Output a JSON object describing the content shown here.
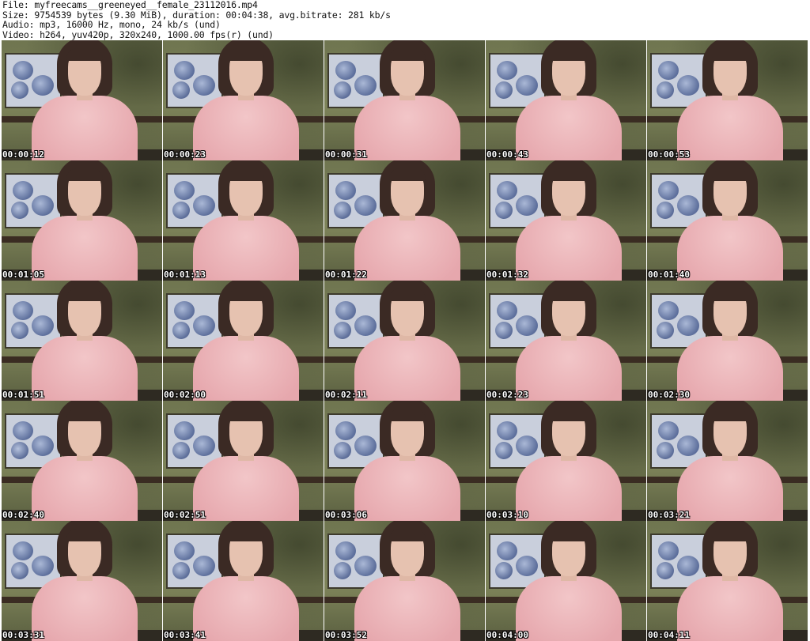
{
  "header": {
    "file_line": "File: myfreecams__greeneyed__female_23112016.mp4",
    "size_line": "Size: 9754539 bytes (9.30 MiB), duration: 00:04:38, avg.bitrate: 281 kb/s",
    "audio_line": "Audio: mp3, 16000 Hz, mono, 24 kb/s (und)",
    "video_line": "Video: h264, yuv420p, 320x240, 1000.00 fps(r) (und)"
  },
  "thumbnails": [
    {
      "timestamp": "00:00:12"
    },
    {
      "timestamp": "00:00:23"
    },
    {
      "timestamp": "00:00:31"
    },
    {
      "timestamp": "00:00:43"
    },
    {
      "timestamp": "00:00:53"
    },
    {
      "timestamp": "00:01:05"
    },
    {
      "timestamp": "00:01:13"
    },
    {
      "timestamp": "00:01:22"
    },
    {
      "timestamp": "00:01:32"
    },
    {
      "timestamp": "00:01:40"
    },
    {
      "timestamp": "00:01:51"
    },
    {
      "timestamp": "00:02:00"
    },
    {
      "timestamp": "00:02:11"
    },
    {
      "timestamp": "00:02:23"
    },
    {
      "timestamp": "00:02:30"
    },
    {
      "timestamp": "00:02:40"
    },
    {
      "timestamp": "00:02:51"
    },
    {
      "timestamp": "00:03:06"
    },
    {
      "timestamp": "00:03:10"
    },
    {
      "timestamp": "00:03:21"
    },
    {
      "timestamp": "00:03:31"
    },
    {
      "timestamp": "00:03:41"
    },
    {
      "timestamp": "00:03:52"
    },
    {
      "timestamp": "00:04:00"
    },
    {
      "timestamp": "00:04:11"
    }
  ],
  "colors": {
    "background": "#ffffff",
    "sweater": "#eab0b6",
    "wall": "#767c54"
  }
}
